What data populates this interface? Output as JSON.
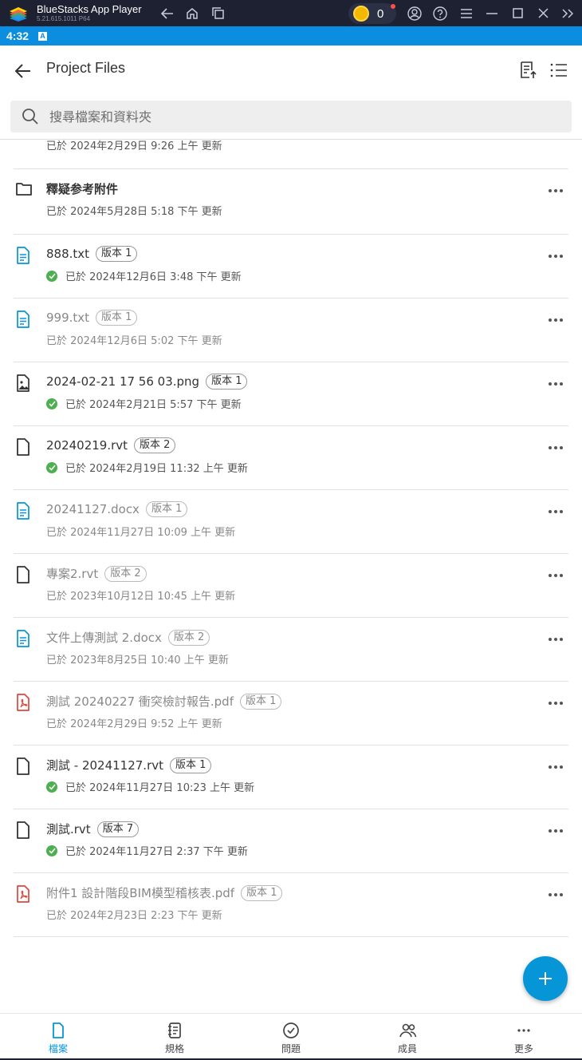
{
  "emulator": {
    "title": "BlueStacks App Player",
    "version": "5.21.615.1011  P64",
    "coins": "0"
  },
  "status_bar": {
    "time": "4:32",
    "indicator": "A"
  },
  "header": {
    "title": "Project Files"
  },
  "search": {
    "placeholder": "搜尋檔案和資料夾"
  },
  "files": [
    {
      "kind": "folder",
      "name": "",
      "version": "",
      "synced": false,
      "dim": false,
      "updated": "已於 2024年2月29日 9:26 上午 更新"
    },
    {
      "kind": "folder",
      "name": "釋疑参考附件",
      "version": "",
      "synced": false,
      "dim": false,
      "updated": "已於 2024年5月28日 5:18 下午 更新"
    },
    {
      "kind": "doc",
      "name": "888.txt",
      "version": "版本 1",
      "synced": true,
      "dim": false,
      "updated": "已於 2024年12月6日 3:48 下午 更新"
    },
    {
      "kind": "doc",
      "name": "999.txt",
      "version": "版本 1",
      "synced": false,
      "dim": true,
      "updated": "已於 2024年12月6日 5:02 下午 更新"
    },
    {
      "kind": "image",
      "name": "2024-02-21 17 56 03.png",
      "version": "版本 1",
      "synced": true,
      "dim": false,
      "updated": "已於 2024年2月21日 5:57 下午 更新"
    },
    {
      "kind": "file",
      "name": "20240219.rvt",
      "version": "版本 2",
      "synced": true,
      "dim": false,
      "updated": "已於 2024年2月19日 11:32 上午 更新"
    },
    {
      "kind": "doc",
      "name": "20241127.docx",
      "version": "版本 1",
      "synced": false,
      "dim": true,
      "updated": "已於 2024年11月27日 10:09 上午 更新"
    },
    {
      "kind": "file",
      "name": "專案2.rvt",
      "version": "版本 2",
      "synced": false,
      "dim": true,
      "updated": "已於 2023年10月12日 10:45 上午 更新"
    },
    {
      "kind": "doc",
      "name": "文件上傳測試 2.docx",
      "version": "版本 2",
      "synced": false,
      "dim": true,
      "updated": "已於 2023年8月25日 10:40 上午 更新"
    },
    {
      "kind": "pdf",
      "name": "測試 20240227 衝突檢討報告.pdf",
      "version": "版本 1",
      "synced": false,
      "dim": true,
      "updated": "已於 2024年2月29日 9:52 上午 更新"
    },
    {
      "kind": "file",
      "name": "測試 - 20241127.rvt",
      "version": "版本 1",
      "synced": true,
      "dim": false,
      "updated": "已於 2024年11月27日 10:23 上午 更新"
    },
    {
      "kind": "file",
      "name": "測試.rvt",
      "version": "版本 7",
      "synced": true,
      "dim": false,
      "updated": "已於 2024年11月27日 2:37 下午 更新"
    },
    {
      "kind": "pdf",
      "name": "附件1 設計階段BIM模型稽核表.pdf",
      "version": "版本 1",
      "synced": false,
      "dim": true,
      "updated": "已於 2024年2月23日 2:23 下午 更新"
    }
  ],
  "bottom_nav": [
    {
      "label": "檔案",
      "icon": "file-icon",
      "active": true
    },
    {
      "label": "規格",
      "icon": "notebook-icon",
      "active": false
    },
    {
      "label": "問題",
      "icon": "check-circle-icon",
      "active": false
    },
    {
      "label": "成員",
      "icon": "members-icon",
      "active": false
    },
    {
      "label": "更多",
      "icon": "more-icon",
      "active": false
    }
  ],
  "colors": {
    "accent": "#0696d7",
    "status_bar": "#0b8ee0",
    "synced": "#4caf50",
    "pdf": "#e2453c"
  }
}
